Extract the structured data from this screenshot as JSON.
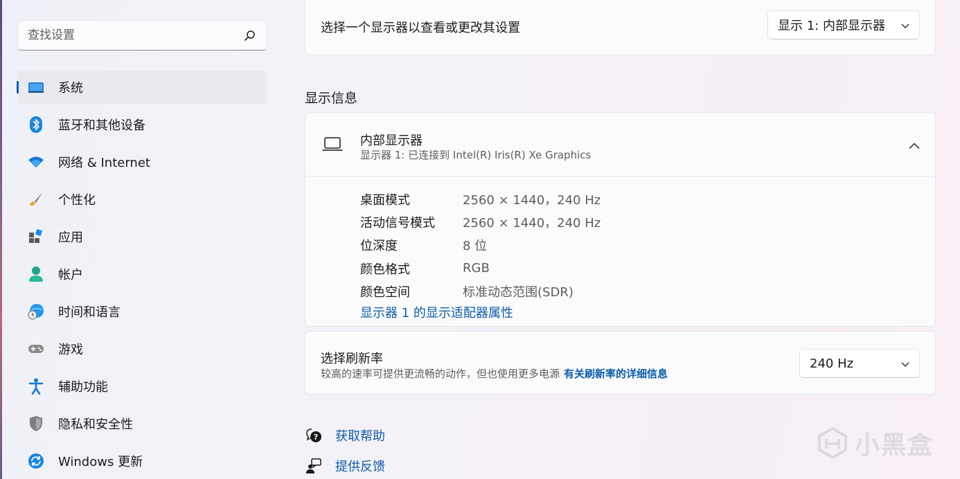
{
  "search": {
    "placeholder": "查找设置"
  },
  "sidebar": {
    "items": [
      {
        "label": "系统",
        "icon": "monitor-icon",
        "active": true
      },
      {
        "label": "蓝牙和其他设备",
        "icon": "bluetooth-icon"
      },
      {
        "label": "网络 & Internet",
        "icon": "wifi-icon"
      },
      {
        "label": "个性化",
        "icon": "brush-icon"
      },
      {
        "label": "应用",
        "icon": "apps-icon"
      },
      {
        "label": "帐户",
        "icon": "account-icon"
      },
      {
        "label": "时间和语言",
        "icon": "globe-clock-icon"
      },
      {
        "label": "游戏",
        "icon": "gamepad-icon"
      },
      {
        "label": "辅助功能",
        "icon": "accessibility-icon"
      },
      {
        "label": "隐私和安全性",
        "icon": "shield-icon"
      },
      {
        "label": "Windows 更新",
        "icon": "update-icon"
      }
    ]
  },
  "display_select": {
    "label": "选择一个显示器以查看或更改其设置",
    "selected": "显示 1: 内部显示器"
  },
  "display_info": {
    "section_title": "显示信息",
    "name": "内部显示器",
    "subtitle": "显示器 1: 已连接到 Intel(R) Iris(R) Xe Graphics",
    "rows": [
      {
        "key": "桌面模式",
        "value": "2560 × 1440，240 Hz"
      },
      {
        "key": "活动信号模式",
        "value": "2560 × 1440，240 Hz"
      },
      {
        "key": "位深度",
        "value": "8 位"
      },
      {
        "key": "颜色格式",
        "value": "RGB"
      },
      {
        "key": "颜色空间",
        "value": "标准动态范围(SDR)"
      }
    ],
    "adapter_link": "显示器 1 的显示适配器属性"
  },
  "refresh": {
    "title": "选择刷新率",
    "desc": "较高的速率可提供更流畅的动作，但也使用更多电源",
    "link": "有关刷新率的详细信息",
    "selected": "240 Hz"
  },
  "help": {
    "get_help": "获取帮助",
    "feedback": "提供反馈"
  },
  "watermark": {
    "text": "小黑盒"
  },
  "colors": {
    "accent": "#005fb8",
    "link": "#0b5cad"
  }
}
